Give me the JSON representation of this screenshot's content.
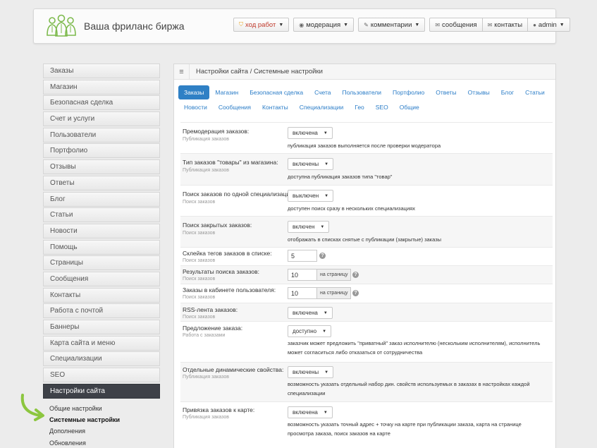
{
  "header": {
    "site_name": "Ваша фриланс биржа",
    "logo_color": "#7dba4d",
    "nav": [
      {
        "label": "ход работ",
        "icon": "shield-icon"
      },
      {
        "label": "модерация",
        "icon": "eye-icon"
      },
      {
        "label": "комментарии",
        "icon": "pencil-icon"
      },
      {
        "label": "сообщения",
        "icon": "envelope-icon"
      },
      {
        "label": "контакты",
        "icon": "contacts-icon"
      },
      {
        "label": "admin",
        "icon": "user-icon"
      }
    ]
  },
  "sidebar": {
    "items": [
      "Заказы",
      "Магазин",
      "Безопасная сделка",
      "Счет и услуги",
      "Пользователи",
      "Портфолио",
      "Отзывы",
      "Ответы",
      "Блог",
      "Статьи",
      "Новости",
      "Помощь",
      "Страницы",
      "Сообщения",
      "Контакты",
      "Работа с почтой",
      "Баннеры",
      "Карта сайта и меню",
      "Специализации",
      "SEO",
      "Настройки сайта"
    ],
    "sub_items": [
      "Общие настройки",
      "Системные настройки",
      "Дополнения",
      "Обновления"
    ]
  },
  "panel": {
    "breadcrumb": "Настройки сайта / Системные настройки",
    "tabs_row1": [
      "Заказы",
      "Магазин",
      "Безопасная сделка",
      "Счета",
      "Пользователи",
      "Портфолио",
      "Ответы",
      "Отзывы",
      "Блог",
      "Статьи"
    ],
    "tabs_row2": [
      "Новости",
      "Сообщения",
      "Контакты",
      "Специализации",
      "Гео",
      "SEO",
      "Общие"
    ],
    "accent_color": "#2f80c5",
    "settings": [
      {
        "label": "Премодерация заказов:",
        "hint": "Публикация заказов",
        "value": "включена",
        "desc": "публикация заказов выполняется после проверки модератора"
      },
      {
        "label": "Тип заказов \"товары\" из магазина:",
        "hint": "Публикация заказов",
        "value": "включены",
        "desc": "доступна публикация заказов типа \"товар\""
      },
      {
        "label": "Поиск заказов по одной специализации:",
        "hint": "Поиск заказов",
        "value": "выключен",
        "desc": "доступен поиск сразу в нескольких специализациях"
      },
      {
        "label": "Поиск закрытых заказов:",
        "hint": "Поиск заказов",
        "value": "включен",
        "desc": "отображать в списках снятые с публикации (закрытые) заказы"
      },
      {
        "label": "Склейка тегов заказов в списке:",
        "hint": "Поиск заказов",
        "value": "5"
      },
      {
        "label": "Результаты поиска заказов:",
        "hint": "Поиск заказов",
        "value": "10",
        "addon": "на страницу"
      },
      {
        "label": "Заказы в кабинете пользователя:",
        "hint": "Поиск заказов",
        "value": "10",
        "addon": "на страницу"
      },
      {
        "label": "RSS-лента заказов:",
        "hint": "Поиск заказов",
        "value": "включена"
      },
      {
        "label": "Предложение заказа:",
        "hint": "Работа с заказами",
        "value": "доступно",
        "desc": "заказчик может предложить \"приватный\" заказ исполнителю (нескольким исполнителям), исполнитель может согласиться либо отказаться от сотрудничества"
      },
      {
        "label": "Отдельные динамические свойства:",
        "hint": "Публикация заказов",
        "value": "включены",
        "desc": "возможность указать отдельный набор дин. свойств используемых в заказах в настройках каждой специализации"
      },
      {
        "label": "Привязка заказов к карте:",
        "hint": "Публикация заказов",
        "value": "включена",
        "desc": "возможность указать точный адрес + точку на карте при публикации заказа, карта на странице просмотра заказа, поиск заказов на карте"
      }
    ]
  }
}
